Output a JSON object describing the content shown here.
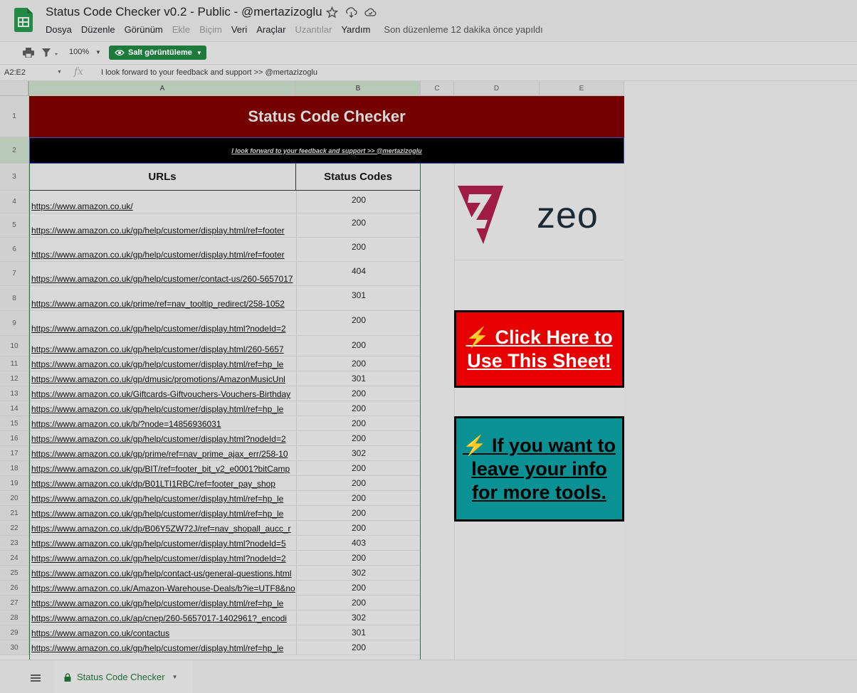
{
  "doc": {
    "title": "Status Code Checker v0.2 - Public - @mertazizoglu",
    "last_edit": "Son düzenleme 12 dakika önce yapıldı"
  },
  "menu": [
    {
      "label": "Dosya",
      "disabled": false
    },
    {
      "label": "Düzenle",
      "disabled": false
    },
    {
      "label": "Görünüm",
      "disabled": false
    },
    {
      "label": "Ekle",
      "disabled": true
    },
    {
      "label": "Biçim",
      "disabled": true
    },
    {
      "label": "Veri",
      "disabled": false
    },
    {
      "label": "Araçlar",
      "disabled": false
    },
    {
      "label": "Uzantılar",
      "disabled": true
    },
    {
      "label": "Yardım",
      "disabled": false
    }
  ],
  "toolbar": {
    "zoom": "100%",
    "view_only_label": "Salt görüntüleme"
  },
  "formula_bar": {
    "name_box": "A2:E2",
    "content": "I look forward to your feedback and support  >> @mertazizoglu"
  },
  "columns": [
    "A",
    "B",
    "C",
    "D",
    "E"
  ],
  "sheet": {
    "banner_title": "Status Code Checker",
    "subtitle": "I look forward to your feedback and support  >> @mertazizoglu",
    "header_urls": "URLs",
    "header_codes": "Status Codes",
    "logo_text": "zeo",
    "cta_button": "⚡ Click Here to Use This Sheet!",
    "info_button": "⚡ If you want to leave your info for more tools.",
    "rows": [
      {
        "url": "https://www.amazon.co.uk/",
        "code": "200"
      },
      {
        "url": "https://www.amazon.co.uk/gp/help/customer/display.html/ref=footer",
        "code": "200"
      },
      {
        "url": "https://www.amazon.co.uk/gp/help/customer/display.html/ref=footer",
        "code": "200"
      },
      {
        "url": "https://www.amazon.co.uk/gp/help/customer/contact-us/260-5657017",
        "code": "404"
      },
      {
        "url": "https://www.amazon.co.uk/prime/ref=nav_tooltip_redirect/258-1052",
        "code": "301"
      },
      {
        "url": "https://www.amazon.co.uk/gp/help/customer/display.html?nodeId=2",
        "code": "200"
      },
      {
        "url": "https://www.amazon.co.uk/gp/help/customer/display.html/260-5657",
        "code": "200"
      },
      {
        "url": "https://www.amazon.co.uk/gp/help/customer/display.html/ref=hp_le",
        "code": "200"
      },
      {
        "url": "https://www.amazon.co.uk/gp/dmusic/promotions/AmazonMusicUnl",
        "code": "301"
      },
      {
        "url": "https://www.amazon.co.uk/Giftcards-Giftvouchers-Vouchers-Birthday",
        "code": "200"
      },
      {
        "url": "https://www.amazon.co.uk/gp/help/customer/display.html/ref=hp_le",
        "code": "200"
      },
      {
        "url": "https://www.amazon.co.uk/b/?node=14856936031",
        "code": "200"
      },
      {
        "url": "https://www.amazon.co.uk/gp/help/customer/display.html?nodeId=2",
        "code": "200"
      },
      {
        "url": "https://www.amazon.co.uk/gp/prime/ref=nav_prime_ajax_err/258-10",
        "code": "302"
      },
      {
        "url": "https://www.amazon.co.uk/gp/BIT/ref=footer_bit_v2_e0001?bitCamp",
        "code": "200"
      },
      {
        "url": "https://www.amazon.co.uk/dp/B01LTI1RBC/ref=footer_pay_shop",
        "code": "200"
      },
      {
        "url": "https://www.amazon.co.uk/gp/help/customer/display.html/ref=hp_le",
        "code": "200"
      },
      {
        "url": "https://www.amazon.co.uk/gp/help/customer/display.html/ref=hp_le",
        "code": "200"
      },
      {
        "url": "https://www.amazon.co.uk/dp/B06Y5ZW72J/ref=nav_shopall_aucc_r",
        "code": "200"
      },
      {
        "url": "https://www.amazon.co.uk/gp/help/customer/display.html?nodeId=5",
        "code": "403"
      },
      {
        "url": "https://www.amazon.co.uk/gp/help/customer/display.html?nodeId=2",
        "code": "200"
      },
      {
        "url": "https://www.amazon.co.uk/gp/help/contact-us/general-questions.html",
        "code": "302"
      },
      {
        "url": "https://www.amazon.co.uk/Amazon-Warehouse-Deals/b?ie=UTF8&no",
        "code": "200"
      },
      {
        "url": "https://www.amazon.co.uk/gp/help/customer/display.html/ref=hp_le",
        "code": "200"
      },
      {
        "url": "https://www.amazon.co.uk/ap/cnep/260-5657017-1402961?_encodi",
        "code": "302"
      },
      {
        "url": "https://www.amazon.co.uk/contactus",
        "code": "301"
      },
      {
        "url": "https://www.amazon.co.uk/gp/help/customer/display.html/ref=hp_le",
        "code": "200"
      }
    ]
  },
  "tab": {
    "label": "Status Code Checker"
  },
  "colors": {
    "banner": "#740000",
    "cta_red": "#e60000",
    "info_teal": "#0a9194",
    "accent_green": "#1e7a3c",
    "logo_mark": "#a01c46"
  }
}
